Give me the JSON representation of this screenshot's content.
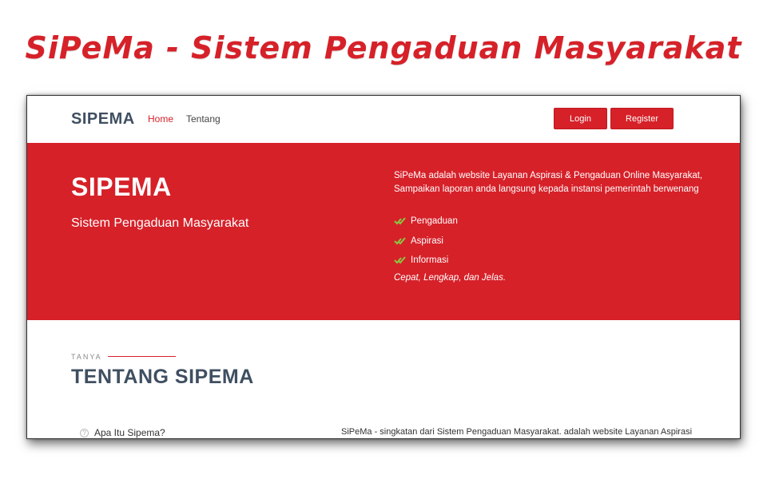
{
  "banner": {
    "title": "SiPeMa - Sistem Pengaduan Masyarakat"
  },
  "navbar": {
    "brand": "SIPEMA",
    "links": [
      {
        "label": "Home",
        "active": true
      },
      {
        "label": "Tentang",
        "active": false
      }
    ],
    "login_label": "Login",
    "register_label": "Register"
  },
  "hero": {
    "title": "SIPEMA",
    "subtitle": "Sistem Pengaduan Masyarakat",
    "description_line1": "SiPeMa adalah website Layanan Aspirasi & Pengaduan Online Masyarakat,",
    "description_line2": "Sampaikan laporan anda langsung kepada instansi pemerintah berwenang",
    "features": [
      {
        "label": "Pengaduan",
        "icon": "check-icon"
      },
      {
        "label": "Aspirasi",
        "icon": "check-icon"
      },
      {
        "label": "Informasi",
        "icon": "check-icon"
      }
    ],
    "tagline": "Cepat, Lengkap, dan Jelas."
  },
  "about": {
    "label": "TANYA",
    "title": "TENTANG SIPEMA",
    "faq": [
      {
        "question": "Apa Itu Sipema?",
        "icon": "help-icon"
      }
    ],
    "text": "SiPeMa - singkatan dari Sistem Pengaduan Masyarakat. adalah website Layanan Aspirasi"
  },
  "colors": {
    "accent": "#d62129",
    "heading": "#3f4f61",
    "check": "#8cc63f"
  }
}
